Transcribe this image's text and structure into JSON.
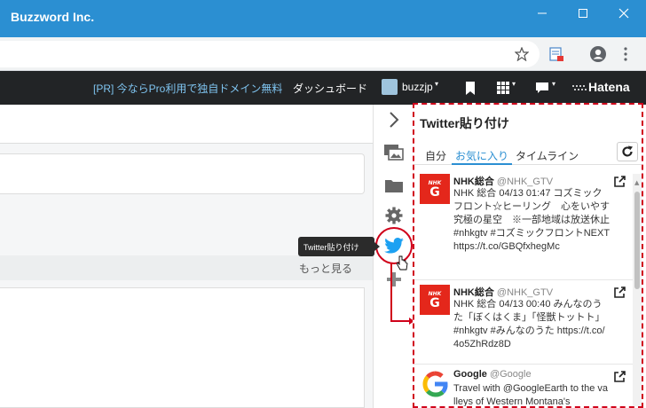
{
  "window": {
    "title": "Buzzword Inc."
  },
  "navbar": {
    "promo": "[PR] 今ならPro利用で独自ドメイン無料",
    "dashboard": "ダッシュボード",
    "username": "buzzjp",
    "brand": "Hatena"
  },
  "main": {
    "more_link": "もっと見る"
  },
  "tooltip": {
    "label": "Twitter貼り付け"
  },
  "panel": {
    "title": "Twitter貼り付け",
    "tabs": [
      "自分",
      "お気に入り",
      "タイムライン"
    ],
    "active_tab": "お気に入り",
    "tweets": [
      {
        "name": "NHK総合",
        "handle": "@NHK_GTV",
        "text": "NHK 総合 04/13 01:47 コズミックフロント☆ヒーリング　心をいやす究極の星空　※一部地域は放送休止 #nhkgtv #コズミックフロントNEXT https://t.co/GBQfxhegMc"
      },
      {
        "name": "NHK総合",
        "handle": "@NHK_GTV",
        "text": "NHK 総合 04/13 00:40 みんなのうた「ぼくはくま」「怪獣トットト」 #nhkgtv #みんなのうた https://t.co/4o5ZhRdz8D"
      },
      {
        "name": "Google",
        "handle": "@Google",
        "text": "Travel with @GoogleEarth to the valleys of Western Montana's"
      }
    ]
  },
  "icons": {
    "chevron": "chevron-right-icon",
    "photo": "photo-icon",
    "folder": "folder-icon",
    "gear": "gear-icon",
    "twitter": "twitter-icon",
    "refresh": "refresh-icon",
    "external": "external-link-icon"
  },
  "colors": {
    "titlebar": "#2b8fd2",
    "navbar": "#222426",
    "twitter": "#1da1f2",
    "highlight": "#d0021b",
    "nhk": "#e4271b",
    "tab_active": "#2b8fd2"
  }
}
